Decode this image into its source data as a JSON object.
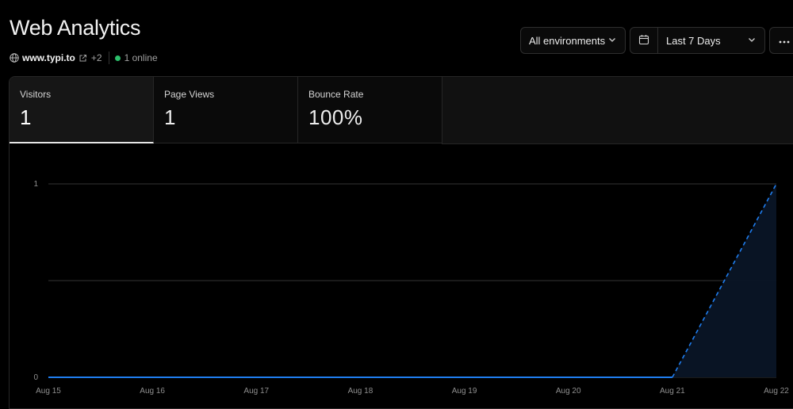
{
  "page": {
    "title": "Web Analytics",
    "site": "www.typi.to",
    "extra_domains": "+2",
    "online": "1 online"
  },
  "filters": {
    "environment": "All environments",
    "range": "Last 7 Days"
  },
  "icons": {
    "globe": "globe-icon",
    "external_link": "external-link-icon",
    "online_dot": "status-dot-icon",
    "calendar": "calendar-icon",
    "chevron": "chevron-down-icon",
    "more": "more-horizontal-icon"
  },
  "tabs": [
    {
      "label": "Visitors",
      "value": "1",
      "active": true
    },
    {
      "label": "Page Views",
      "value": "1",
      "active": false
    },
    {
      "label": "Bounce Rate",
      "value": "100%",
      "active": false
    }
  ],
  "colors": {
    "background": "#000000",
    "accent_line": "#1f7ef0",
    "area_fill": "#0a1526",
    "online": "#2cbf6b"
  },
  "chart_data": {
    "type": "line",
    "x": [
      "Aug 15",
      "Aug 16",
      "Aug 17",
      "Aug 18",
      "Aug 19",
      "Aug 20",
      "Aug 21",
      "Aug 22"
    ],
    "series": [
      {
        "values": [
          0,
          0,
          0,
          0,
          0,
          0,
          0,
          1
        ],
        "partial_last_segment": true
      }
    ],
    "y_ticks": [
      "0",
      "1"
    ],
    "ylim": [
      0,
      1
    ],
    "grid": true,
    "legend": "none"
  }
}
